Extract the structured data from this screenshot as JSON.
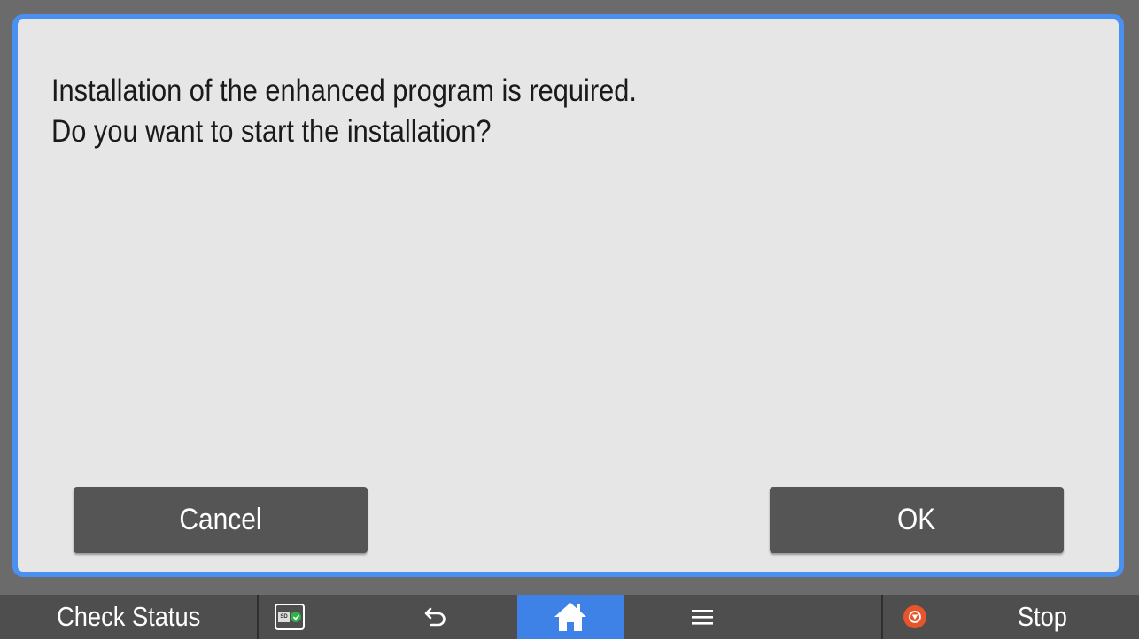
{
  "dialog": {
    "message_line1": "Installation of the enhanced program is required.",
    "message_line2": "Do you want to start the installation?",
    "cancel_label": "Cancel",
    "ok_label": "OK"
  },
  "taskbar": {
    "check_status_label": "Check Status",
    "sd_icon_text": "SD",
    "stop_label": "Stop",
    "icons": [
      "sd-card-status-icon",
      "back-icon",
      "home-icon",
      "menu-icon",
      "stop-icon"
    ]
  },
  "colors": {
    "dialog_border": "#4a90f0",
    "dialog_background": "#e6e6e6",
    "button_background": "#555555",
    "taskbar_background": "#4e4e4e",
    "home_highlight": "#3e82e8",
    "stop_icon": "#e8552a",
    "sd_status_ok": "#2fb24a"
  }
}
